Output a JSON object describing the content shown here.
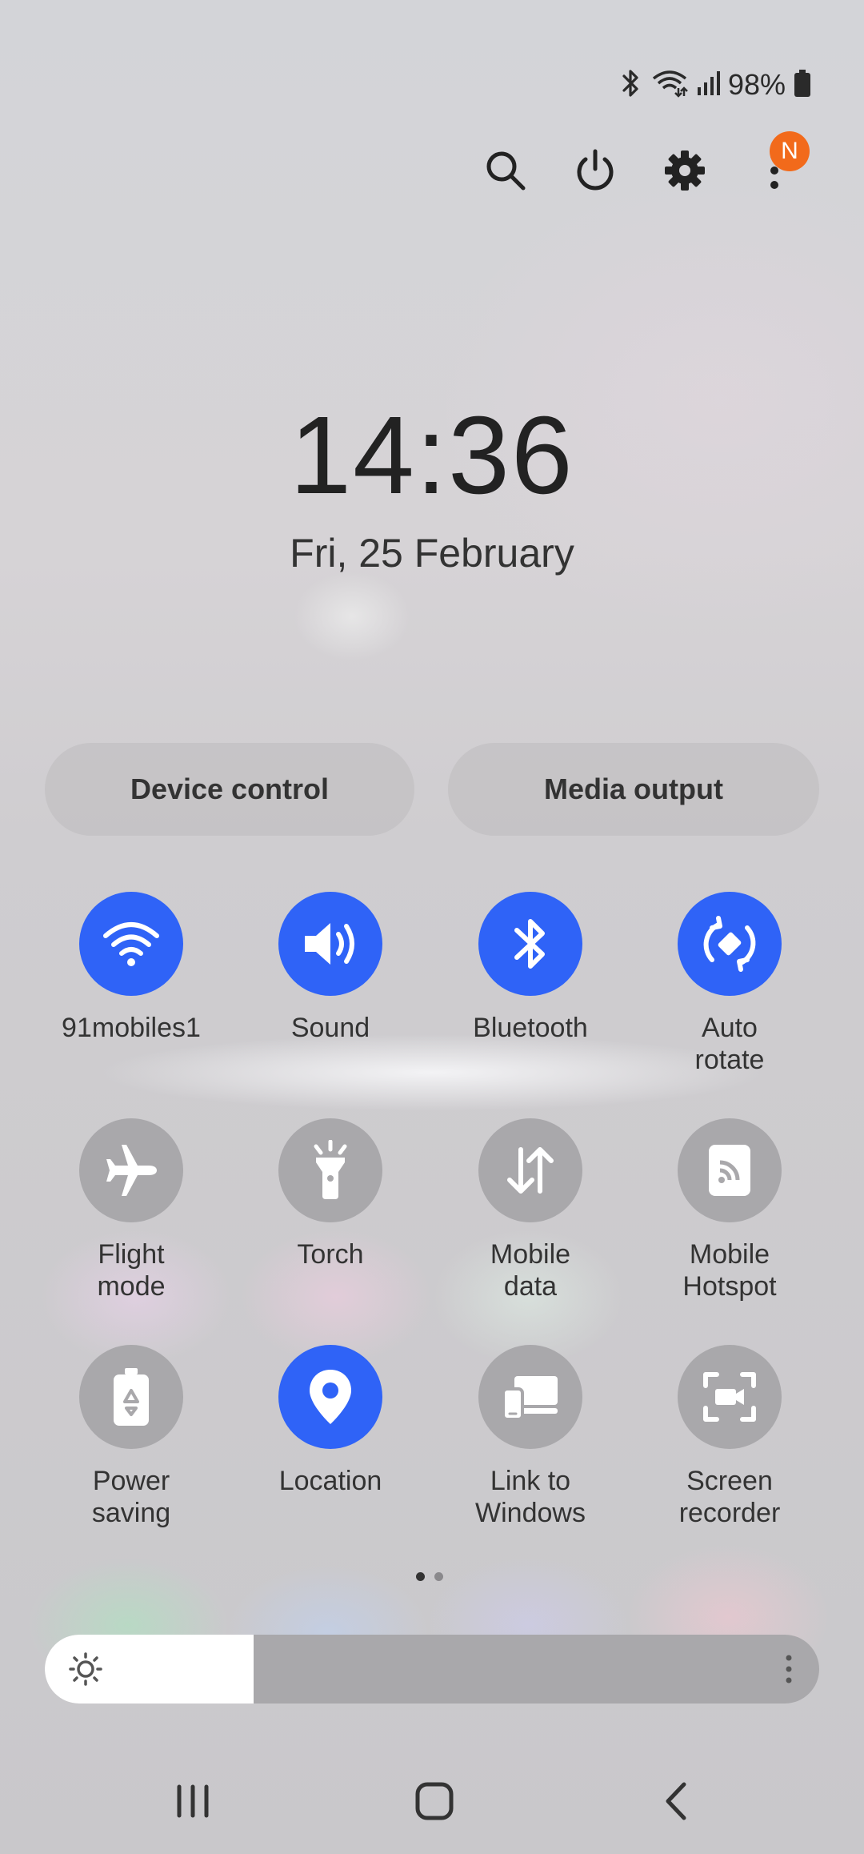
{
  "status_bar": {
    "battery_percent": "98%",
    "icons": [
      "bluetooth-icon",
      "wifi-icon",
      "signal-icon",
      "battery-icon"
    ]
  },
  "top_actions": {
    "search": "search-icon",
    "power": "power-icon",
    "settings": "gear-icon",
    "more": "more-vert-icon",
    "notification_badge": "N"
  },
  "clock": {
    "time": "14:36",
    "date": "Fri, 25 February"
  },
  "shortcuts": {
    "device_control": "Device control",
    "media_output": "Media output"
  },
  "tiles": [
    {
      "label": "91mobiles1",
      "icon": "wifi-icon",
      "state": "on"
    },
    {
      "label": "Sound",
      "icon": "sound-icon",
      "state": "on"
    },
    {
      "label": "Bluetooth",
      "icon": "bluetooth-icon",
      "state": "on"
    },
    {
      "label": "Auto\nrotate",
      "icon": "auto-rotate-icon",
      "state": "on"
    },
    {
      "label": "Flight\nmode",
      "icon": "airplane-icon",
      "state": "off"
    },
    {
      "label": "Torch",
      "icon": "torch-icon",
      "state": "off"
    },
    {
      "label": "Mobile\ndata",
      "icon": "mobile-data-icon",
      "state": "off"
    },
    {
      "label": "Mobile\nHotspot",
      "icon": "hotspot-icon",
      "state": "off"
    },
    {
      "label": "Power\nsaving",
      "icon": "power-saving-icon",
      "state": "off"
    },
    {
      "label": "Location",
      "icon": "location-icon",
      "state": "on"
    },
    {
      "label": "Link to\nWindows",
      "icon": "link-to-windows-icon",
      "state": "off"
    },
    {
      "label": "Screen\nrecorder",
      "icon": "screen-recorder-icon",
      "state": "off"
    }
  ],
  "pager": {
    "pages": 2,
    "current": 1
  },
  "brightness": {
    "level": 0.27
  },
  "colors": {
    "accent": "#2f63f7",
    "tile_off": "#a9a8ab",
    "badge": "#f26a1b"
  },
  "nav_bar": [
    "recents-icon",
    "home-icon",
    "back-icon"
  ]
}
